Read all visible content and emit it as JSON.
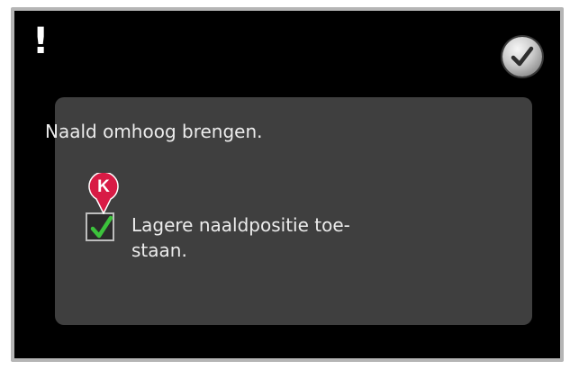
{
  "alert": {
    "symbol": "!"
  },
  "ok_button": {
    "icon": "checkmark-icon",
    "color": "#2e2e2e"
  },
  "dialog": {
    "message": "Naald omhoog brengen.",
    "checkbox": {
      "checked": true,
      "label": "Lagere naaldpositie toe-\nstaan.",
      "check_color": "#3cc23c"
    }
  },
  "callout": {
    "letter": "K",
    "color": "#d81b45"
  }
}
